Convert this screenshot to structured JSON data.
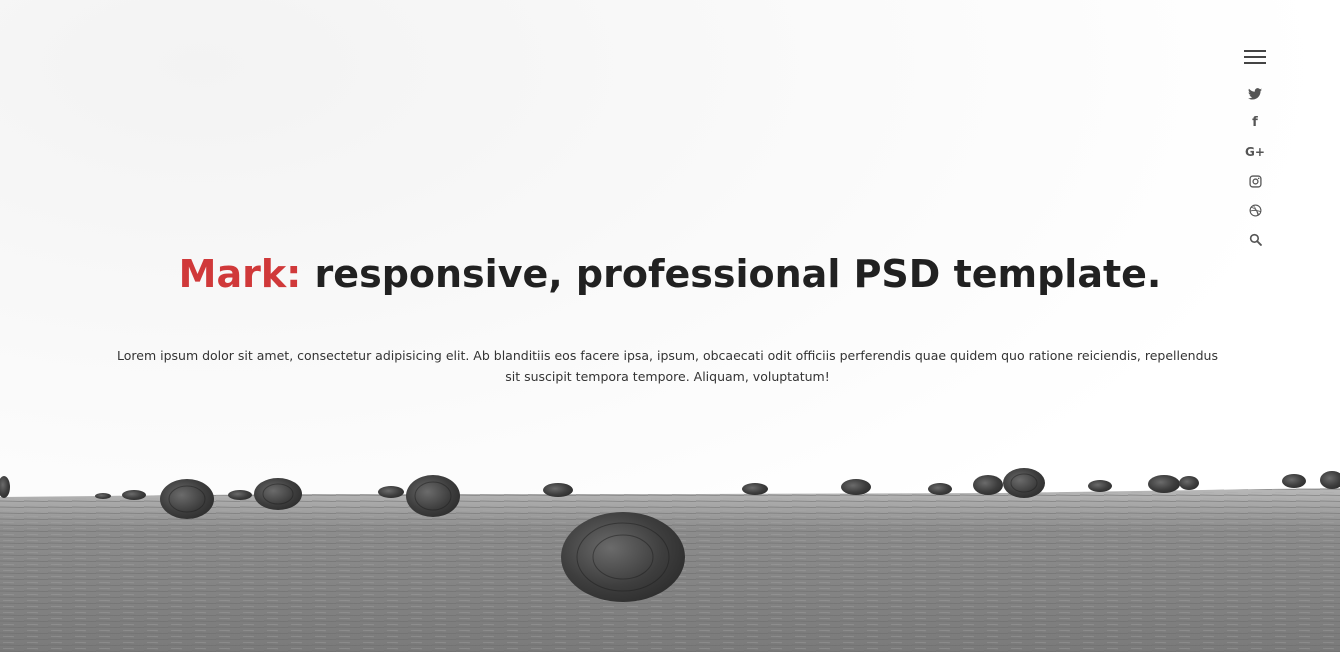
{
  "hero": {
    "headline_accent": "Mark:",
    "headline_rest": " responsive, professional PSD template.",
    "lede": "Lorem ipsum dolor sit amet, consectetur adipisicing elit. Ab blanditiis eos facere ipsa, ipsum, obcaecati odit officiis perferendis quae quidem quo ratione reiciendis, repellendus sit suscipit tempora tempore. Aliquam, voluptatum!"
  },
  "sidebar": {
    "menu_icon": "hamburger-icon",
    "icons": [
      "twitter-icon",
      "facebook-icon",
      "google-plus-icon",
      "instagram-icon",
      "dribbble-icon",
      "search-icon"
    ],
    "google_plus_glyph": "G+",
    "facebook_glyph": "f"
  },
  "colors": {
    "accent": "#d0393a",
    "heading": "#212121",
    "body_text": "#333333",
    "icons": "#555555"
  }
}
